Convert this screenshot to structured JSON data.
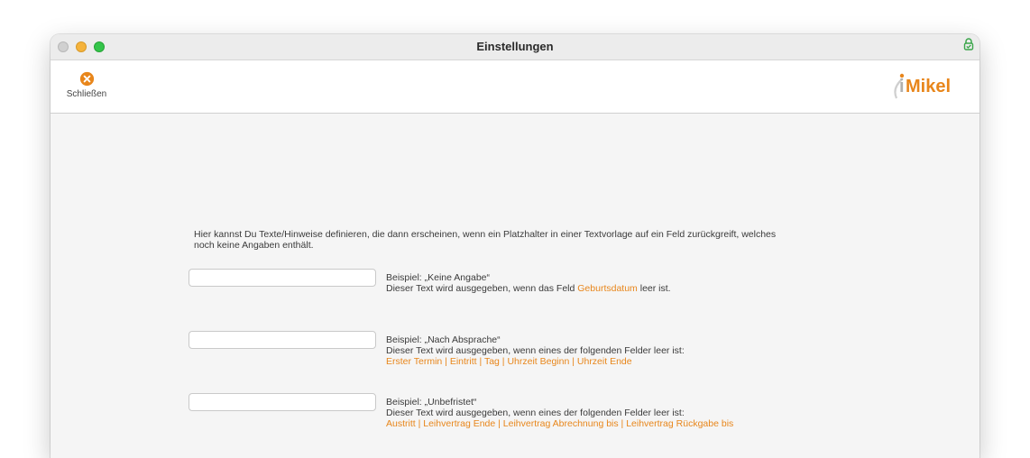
{
  "window": {
    "title": "Einstellungen"
  },
  "toolbar": {
    "close_label": "Schließen"
  },
  "brand": {
    "name_prefix": "i",
    "name_rest": "Mikel"
  },
  "intro": {
    "line1": "Hier kannst Du Texte/Hinweise definieren, die dann erscheinen, wenn ein Platzhalter in einer Textvorlage auf ein Feld zurückgreift, welches",
    "line2": "noch keine Angaben enthält."
  },
  "fields": [
    {
      "value": "",
      "example": "Beispiel: „Keine Angabe“",
      "desc_before": "Dieser Text wird ausgegeben, wenn das Feld ",
      "desc_link": "Geburtsdatum",
      "desc_after": " leer ist."
    },
    {
      "value": "",
      "example": "Beispiel: „Nach Absprache“",
      "desc": "Dieser Text wird ausgegeben, wenn eines der folgenden Felder leer ist:",
      "links": [
        "Erster Termin",
        "Eintritt",
        "Tag",
        "Uhrzeit Beginn",
        "Uhrzeit Ende"
      ]
    },
    {
      "value": "",
      "example": "Beispiel: „Unbefristet“",
      "desc": "Dieser Text wird ausgegeben, wenn eines der folgenden Felder leer ist:",
      "links": [
        "Austritt",
        "Leihvertrag Ende",
        "Leihvertrag Abrechnung bis",
        "Leihvertrag Rückgabe bis"
      ]
    }
  ],
  "separator": " | ",
  "colors": {
    "accent": "#e8861b",
    "lock": "#3aa54a"
  },
  "icons": {
    "toolbar_close": "close-circle-icon",
    "titlebar_lock": "lock-icon"
  }
}
